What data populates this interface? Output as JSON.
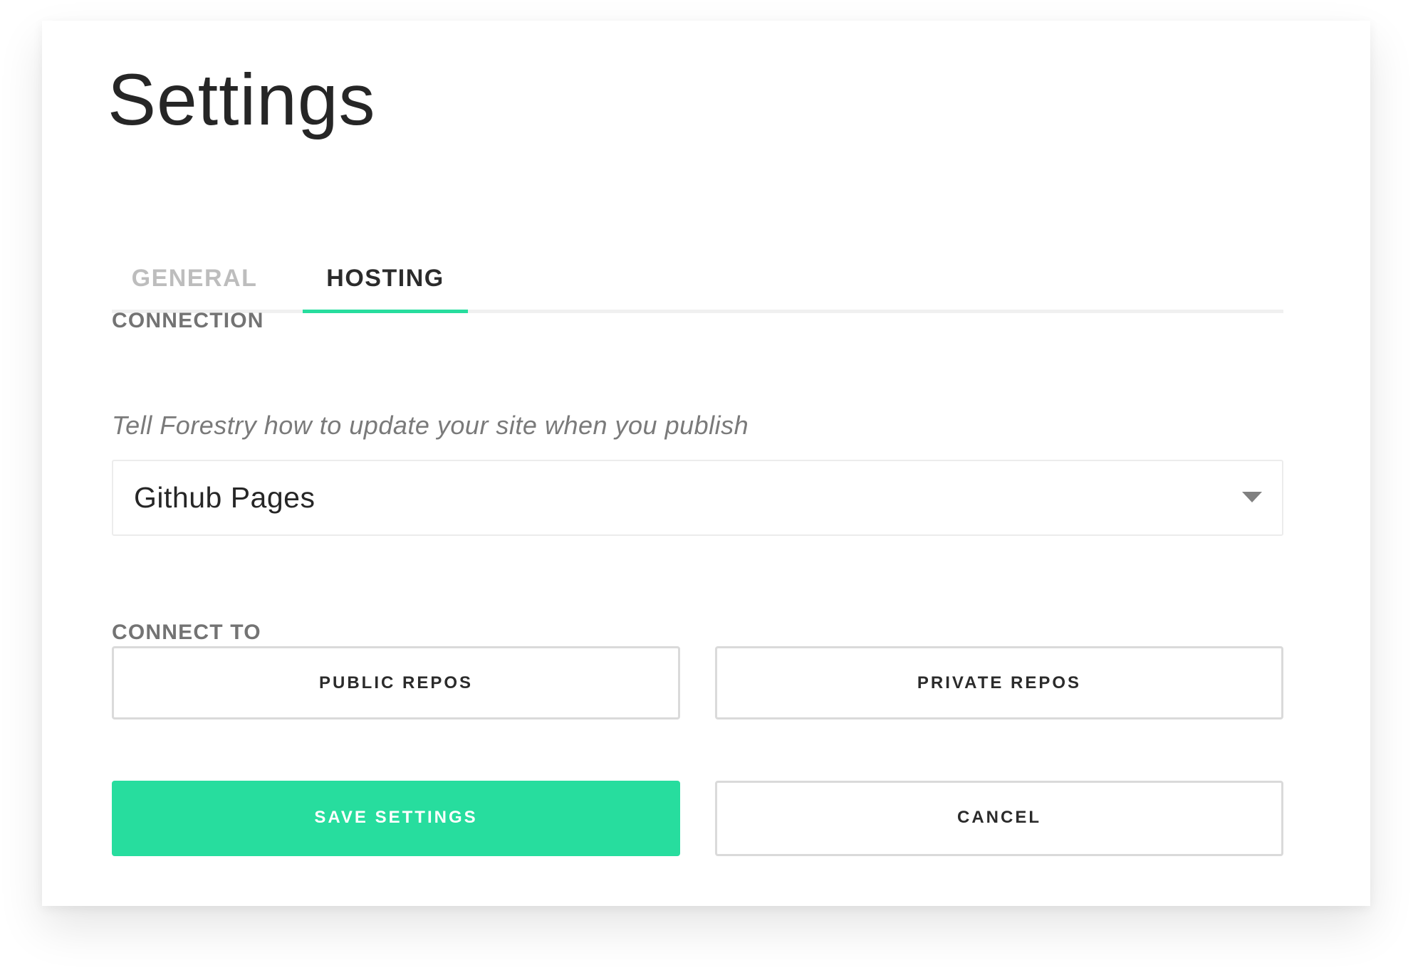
{
  "page": {
    "title": "Settings"
  },
  "tabs": [
    {
      "label": "GENERAL",
      "active": false
    },
    {
      "label": "HOSTING",
      "active": true
    }
  ],
  "connection": {
    "label": "CONNECTION",
    "helper": "Tell Forestry how to update your site when you publish",
    "selected": "Github Pages"
  },
  "connect_to": {
    "label": "CONNECT TO",
    "public_label": "PUBLIC REPOS",
    "private_label": "PRIVATE REPOS"
  },
  "actions": {
    "save_label": "SAVE SETTINGS",
    "cancel_label": "CANCEL"
  },
  "colors": {
    "accent": "#27dd9e",
    "text": "#262626",
    "muted": "#737373",
    "inactive_tab": "#bdbdbd",
    "border": "#dadada"
  },
  "icons": {
    "select_chevron": "chevron-down-icon"
  }
}
